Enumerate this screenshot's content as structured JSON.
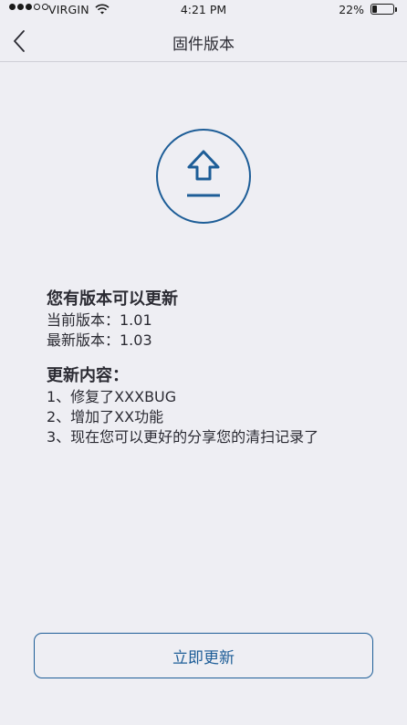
{
  "status_bar": {
    "carrier": "VIRGIN",
    "time": "4:21 PM",
    "battery_percent": "22%",
    "battery_level": 0.22,
    "signal_bars_filled": 3,
    "signal_bars_total": 5
  },
  "nav": {
    "title": "固件版本",
    "back_icon": "chevron-left-icon"
  },
  "hero_icon": "upload-icon",
  "accent_color": "#1d5d97",
  "update_info": {
    "heading": "您有版本可以更新",
    "current_version": "当前版本：1.01",
    "latest_version": "最新版本：1.03"
  },
  "changelog": {
    "heading": "更新内容：",
    "items": [
      "1、修复了XXXBUG",
      "2、增加了XX功能",
      "3、现在您可以更好的分享您的清扫记录了"
    ]
  },
  "actions": {
    "update_now_label": "立即更新"
  }
}
